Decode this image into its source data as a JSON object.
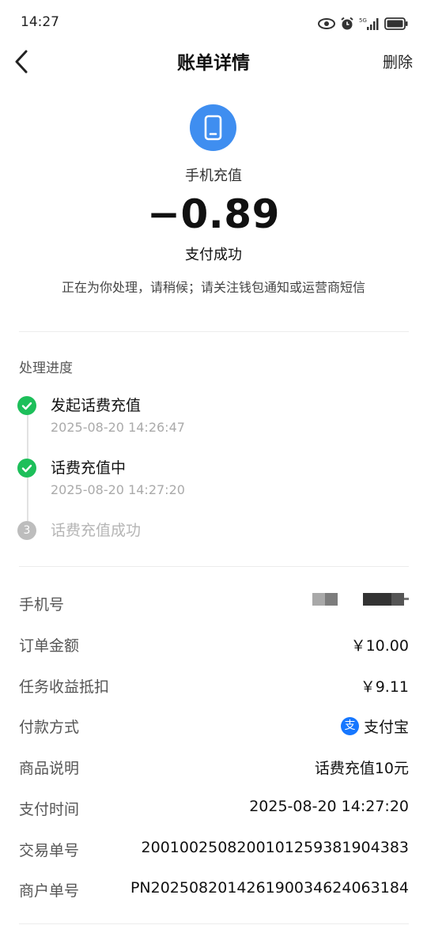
{
  "status_bar": {
    "time": "14:27",
    "network_label": "5G",
    "icons": [
      "eye-icon",
      "alarm-icon",
      "signal-5g-icon",
      "battery-icon"
    ]
  },
  "nav": {
    "title": "账单详情",
    "delete_label": "删除",
    "back_icon": "back-arrow-icon"
  },
  "hero": {
    "icon": "phone-icon",
    "category": "手机充值",
    "amount": "−0.89",
    "status": "支付成功",
    "note": "正在为你处理，请稍候；请关注钱包通知或运营商短信"
  },
  "progress": {
    "title": "处理进度",
    "steps": [
      {
        "title": "发起话费充值",
        "time": "2025-08-20 14:26:47",
        "state": "done"
      },
      {
        "title": "话费充值中",
        "time": "2025-08-20 14:27:20",
        "state": "done"
      },
      {
        "number": "3",
        "title": "话费充值成功",
        "state": "pending"
      }
    ]
  },
  "details": {
    "phone": {
      "label": "手机号",
      "value_masked": true
    },
    "order_amount": {
      "label": "订单金额",
      "value": "￥10.00"
    },
    "task_deduction": {
      "label": "任务收益抵扣",
      "value": "￥9.11"
    },
    "payment_method": {
      "label": "付款方式",
      "value": "支付宝",
      "icon_char": "支",
      "icon": "alipay-icon"
    },
    "product_desc": {
      "label": "商品说明",
      "value": "话费充值10元"
    },
    "pay_time": {
      "label": "支付时间",
      "value": "2025-08-20 14:27:20"
    },
    "trade_no": {
      "label": "交易单号",
      "value": "2001002508200101259381904383"
    },
    "merchant_no": {
      "label": "商户单号",
      "value": "PN2025082014261900346 24063184"
    }
  },
  "colors": {
    "accent_blue": "#3f8ef0",
    "success_green": "#1dbf5a",
    "pending_gray": "#bdbdbd",
    "alipay_blue": "#1677ff"
  }
}
